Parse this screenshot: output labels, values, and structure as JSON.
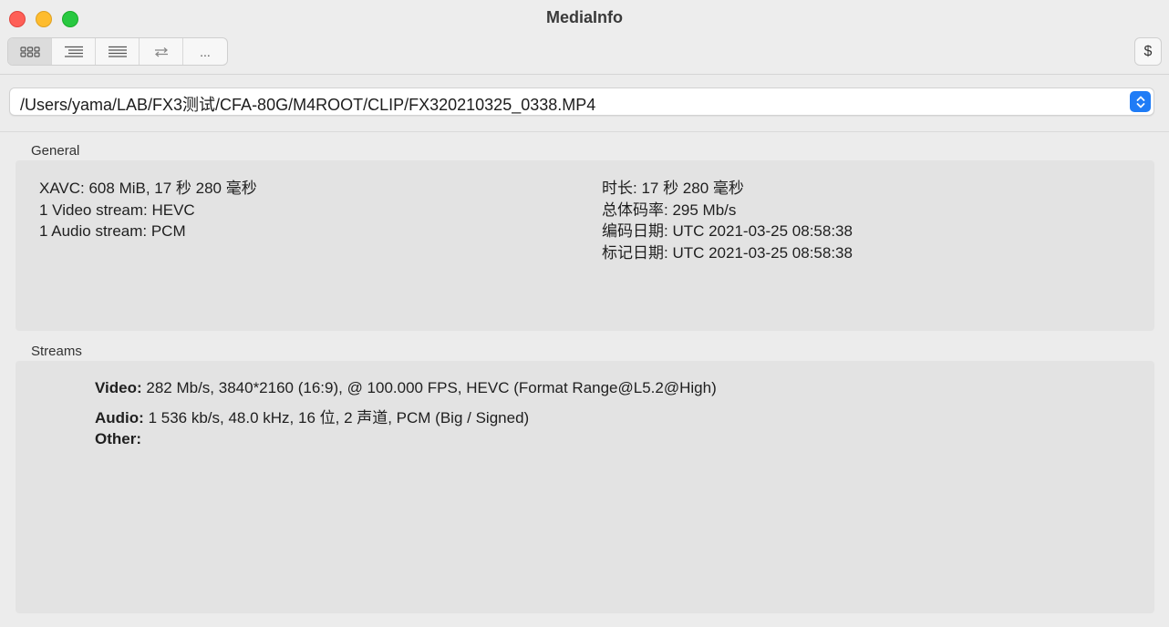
{
  "window": {
    "title": "MediaInfo"
  },
  "toolbar": {
    "view_buttons": [
      {
        "name": "view-basic-icon",
        "label": "",
        "active": true
      },
      {
        "name": "view-sheet-icon",
        "label": "",
        "active": false
      },
      {
        "name": "view-tree-icon",
        "label": "",
        "active": false
      },
      {
        "name": "view-html-icon",
        "label": "",
        "active": false
      },
      {
        "name": "view-more",
        "label": "...",
        "active": false
      }
    ],
    "right_button_label": "$"
  },
  "path": {
    "value": "/Users/yama/LAB/FX3测试/CFA-80G/M4ROOT/CLIP/FX320210325_0338.MP4"
  },
  "general": {
    "label": "General",
    "left": [
      "XAVC: 608 MiB, 17 秒 280 毫秒",
      "1 Video stream: HEVC",
      "1 Audio stream: PCM"
    ],
    "right": [
      "时长: 17 秒 280 毫秒",
      "总体码率: 295 Mb/s",
      "编码日期: UTC 2021-03-25 08:58:38",
      "标记日期: UTC 2021-03-25 08:58:38"
    ]
  },
  "streams": {
    "label": "Streams",
    "rows": [
      {
        "key": "Video:",
        "value": "282 Mb/s, 3840*2160 (16:9), @ 100.000 FPS, HEVC (Format Range@L5.2@High)"
      },
      {
        "key": "Audio:",
        "value": "1 536 kb/s, 48.0 kHz, 16 位, 2 声道, PCM (Big / Signed)"
      },
      {
        "key": "Other:",
        "value": ""
      }
    ]
  }
}
